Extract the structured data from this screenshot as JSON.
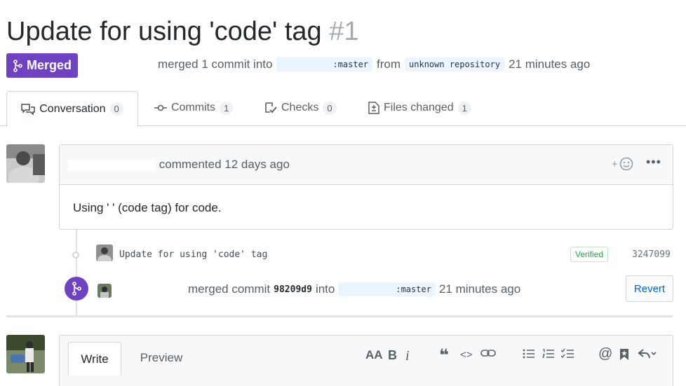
{
  "pr": {
    "title": "Update for using 'code' tag",
    "number": "#1",
    "state": "Merged",
    "meta_pre": "merged 1 commit into",
    "base_branch": ":master",
    "meta_from": "from",
    "head_branch": "unknown repository",
    "meta_time": "21 minutes ago"
  },
  "tabs": [
    {
      "label": "Conversation",
      "count": "0",
      "icon": "comment-discussion-icon"
    },
    {
      "label": "Commits",
      "count": "1",
      "icon": "git-commit-icon"
    },
    {
      "label": "Checks",
      "count": "0",
      "icon": "checklist-icon"
    },
    {
      "label": "Files changed",
      "count": "1",
      "icon": "file-diff-icon"
    }
  ],
  "comment": {
    "action": "commented 12 days ago",
    "body": "Using ' ' (code tag) for code."
  },
  "commit": {
    "message": "Update for using 'code' tag",
    "verified": "Verified",
    "sha": "3247099"
  },
  "merge_event": {
    "prefix": "merged commit",
    "sha": "98209d9",
    "into": "into",
    "branch": ":master",
    "time": "21 minutes ago",
    "revert": "Revert"
  },
  "editor": {
    "write": "Write",
    "preview": "Preview"
  },
  "colors": {
    "merged": "#6f42c1",
    "link": "#0366d6",
    "verified": "#28a745"
  }
}
